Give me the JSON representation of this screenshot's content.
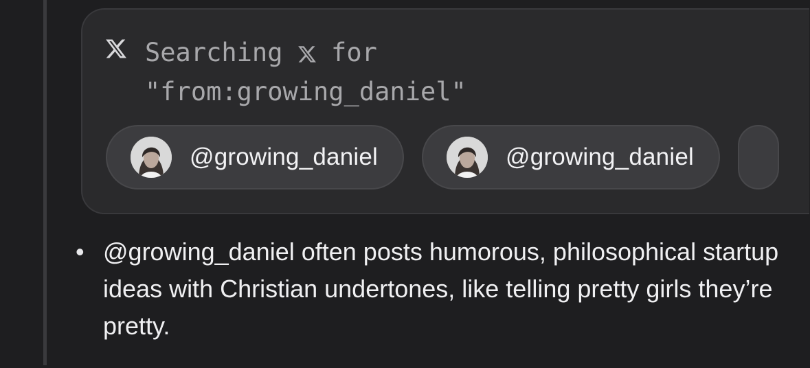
{
  "search": {
    "icon": "x-logo-icon",
    "prefix": "Searching",
    "platform_icon": "x-logo-icon",
    "suffix": "for",
    "query": "\"from:growing_daniel\""
  },
  "results": [
    {
      "handle": "@growing_daniel",
      "avatar_icon": "profile-photo-avatar"
    },
    {
      "handle": "@growing_daniel",
      "avatar_icon": "profile-photo-avatar"
    }
  ],
  "summary": {
    "bullet": "•",
    "text": "@growing_daniel often posts humorous, philosophical startup ideas with Christian undertones, like telling pretty girls they’re pretty."
  },
  "colors": {
    "background": "#1e1e20",
    "card": "#2a2a2c",
    "chip": "#3c3c3f",
    "muted_text": "#a8a8ab",
    "text": "#f0f0f2"
  }
}
